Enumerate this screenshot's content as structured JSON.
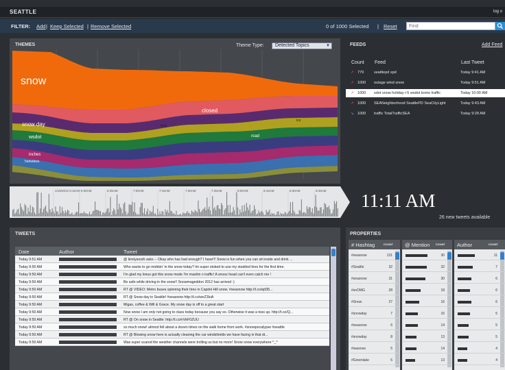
{
  "app": {
    "title": "SEATTLE",
    "logout": "log o"
  },
  "filter": {
    "label": "FILTER:",
    "add": "Add",
    "keep_selected": "Keep Selected",
    "remove_selected": "Remove Selected",
    "separator": "|",
    "selected_count": "0 of 1000  Selected",
    "reset": "Reset",
    "find_placeholder": "Find"
  },
  "themes": {
    "title": "THEMES",
    "theme_type_label": "Theme Type:",
    "theme_type_value": "Detected Topics",
    "topic_labels": [
      "snow",
      "closed",
      "snow day",
      "time",
      "wsdot",
      "road",
      "ice",
      "inches",
      "homeless"
    ],
    "colors": {
      "snow": "#f06a0c",
      "closed": "#e05a60",
      "snow_day": "#5a2a6e",
      "wsdot": "#1f7a3c",
      "road": "#3a3c80",
      "ice": "#b0a020",
      "inches": "#a52a6e",
      "homeless": "#3a6fb0"
    }
  },
  "timeline": {
    "tick_labels": [
      "1/18/2012 6:15AM",
      "6:30AM",
      "6:45AM",
      "7:00AM",
      "7:15AM",
      "7:30AM",
      "7:45AM",
      "8:00AM",
      "8:15AM",
      "8:30AM",
      "8:45AM"
    ]
  },
  "clock": {
    "time": "11:11 AM",
    "new_tweets": "26 new tweets available"
  },
  "feeds": {
    "title": "FEEDS",
    "add_feed": "Add Feed",
    "columns": {
      "count": "Count",
      "feed": "Feed",
      "last_tweet": "Last Tweet"
    },
    "rows": [
      {
        "icon": "up-arrow-icon",
        "count": "779",
        "name": "seattlepd spd",
        "last": "Today 9:41 AM",
        "selected": false
      },
      {
        "icon": "up-arrow-icon",
        "count": "1000",
        "name": "outage wind snow",
        "last": "Today 9:51 AM",
        "selected": false
      },
      {
        "icon": "up-arrow-icon",
        "count": "1000",
        "name": "sdot snow holiday i-5 wsdot komo traffic",
        "last": "Today 10:00 AM",
        "selected": true
      },
      {
        "icon": "up-arrow-icon",
        "count": "1000",
        "name": "SEANeighborhood SeattlePD SeaCityLight",
        "last": "Today 9:43 AM",
        "selected": false
      },
      {
        "icon": "down-arrow-icon",
        "count": "1000",
        "name": "traffic TotalTrafficSEA",
        "last": "Today 9:28 AM",
        "selected": false
      }
    ]
  },
  "tweets": {
    "title": "TWEETS",
    "columns": {
      "date": "Date",
      "author": "Author",
      "tweet": "Tweet"
    },
    "rows": [
      {
        "date": "Today 9:51 AM",
        "tweet": "@ kirstysouth asks -- Okay who has had enough? I have!!! Snow is fun when you can sit inside and drink ..."
      },
      {
        "date": "Today 9:50 AM",
        "tweet": "Who wants to go mobbin' in the snow today? Im super stoked to use my studded tires for the first time."
      },
      {
        "date": "Today 9:50 AM",
        "tweet": "I'm glad my lexus got this snow mode I'm mashin n traffic! A snooz head can't even catch me !"
      },
      {
        "date": "Today 9:50 AM",
        "tweet": "Be safe while driving in the snow!! Snowmageddon 2012 has arrived :)"
      },
      {
        "date": "Today 9:50 AM",
        "tweet": "RT @            VIDEO: Metro buses spinning their tires in Capitol Hill snow. #seasnow http://t.co/qd35..."
      },
      {
        "date": "Today 9:50 AM",
        "tweet": "RT @            Snow day in Seattle! #seasnow http://t.co/wvZ3IuA"
      },
      {
        "date": "Today 9:50 AM",
        "tweet": "Migas, coffee & Will & Grace. My snow day is off to a great start"
      },
      {
        "date": "Today 9:50 AM",
        "tweet": "Now snow I am only not going to class today because you say so. Otherwise it was a toss up. http://t.co/Q..."
      },
      {
        "date": "Today 9:50 AM",
        "tweet": "RT @            On snow in Seattle: http://t.co/nVkF0ZUU"
      },
      {
        "date": "Today 9:50 AM",
        "tweet": "so much snow! almost fell about a dozen times on the walk home from work. #snowpocalypse #seattle"
      },
      {
        "date": "Today 9:50 AM",
        "tweet": "RT @            Blowing snow here is actually cleaning the car windshields we have facing in that di..."
      },
      {
        "date": "Today 9:50 AM",
        "tweet": "Was super scared the weather channels were trolling us but no more! Snow snow everywhere ^_^"
      }
    ]
  },
  "properties": {
    "title": "PROPERTIES",
    "count_label": "COUNT",
    "hashtag_header": "# Hashtag",
    "mention_header": "@ Mention",
    "author_header": "Author",
    "hashtags": [
      {
        "tag": "#seasnow",
        "count": "131"
      },
      {
        "tag": "#Seattle",
        "count": "32"
      },
      {
        "tag": "#seasnow",
        "count": "31"
      },
      {
        "tag": "#snOMG",
        "count": "28"
      },
      {
        "tag": "#Snow",
        "count": "27"
      },
      {
        "tag": "#snowday",
        "count": "7"
      },
      {
        "tag": "#seasnow",
        "count": "6"
      },
      {
        "tag": "#snowday",
        "count": "8"
      },
      {
        "tag": "#wasnow",
        "count": "5"
      },
      {
        "tag": "#Greenlake",
        "count": "5"
      }
    ],
    "mentions": [
      {
        "count": "30",
        "fill": 0.9
      },
      {
        "count": "32",
        "fill": 0.85
      },
      {
        "count": "30",
        "fill": 0.8
      },
      {
        "count": "18",
        "fill": 0.6
      },
      {
        "count": "16",
        "fill": 0.55
      },
      {
        "count": "16",
        "fill": 0.5
      },
      {
        "count": "14",
        "fill": 0.5
      },
      {
        "count": "13",
        "fill": 0.45
      },
      {
        "count": "14",
        "fill": 0.45
      },
      {
        "count": "13",
        "fill": 0.4
      }
    ],
    "authors": [
      {
        "count": "11",
        "fill": 0.7
      },
      {
        "count": "7",
        "fill": 0.6
      },
      {
        "count": "6",
        "fill": 0.55
      },
      {
        "count": "6",
        "fill": 0.5
      },
      {
        "count": "6",
        "fill": 0.55
      },
      {
        "count": "5",
        "fill": 0.5
      },
      {
        "count": "5",
        "fill": 0.45
      },
      {
        "count": "5",
        "fill": 0.45
      },
      {
        "count": "4",
        "fill": 0.4
      },
      {
        "count": "4",
        "fill": 0.4
      }
    ]
  }
}
